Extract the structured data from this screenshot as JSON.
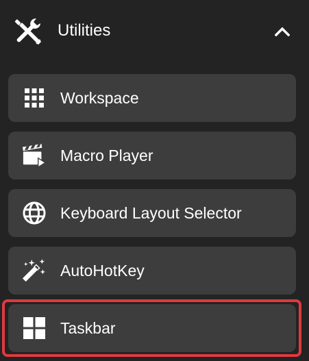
{
  "section": {
    "title": "Utilities",
    "icon": "tools-icon",
    "collapse_icon": "chevron-up-icon"
  },
  "items": [
    {
      "label": "Workspace",
      "icon": "grid-icon"
    },
    {
      "label": "Macro Player",
      "icon": "clapperboard-icon"
    },
    {
      "label": "Keyboard Layout Selector",
      "icon": "globe-icon"
    },
    {
      "label": "AutoHotKey",
      "icon": "magic-wand-icon"
    },
    {
      "label": "Taskbar",
      "icon": "windows-icon"
    }
  ],
  "colors": {
    "background": "#232323",
    "item_background": "#3d3d3d",
    "highlight": "#e0393e",
    "text": "#ffffff"
  }
}
